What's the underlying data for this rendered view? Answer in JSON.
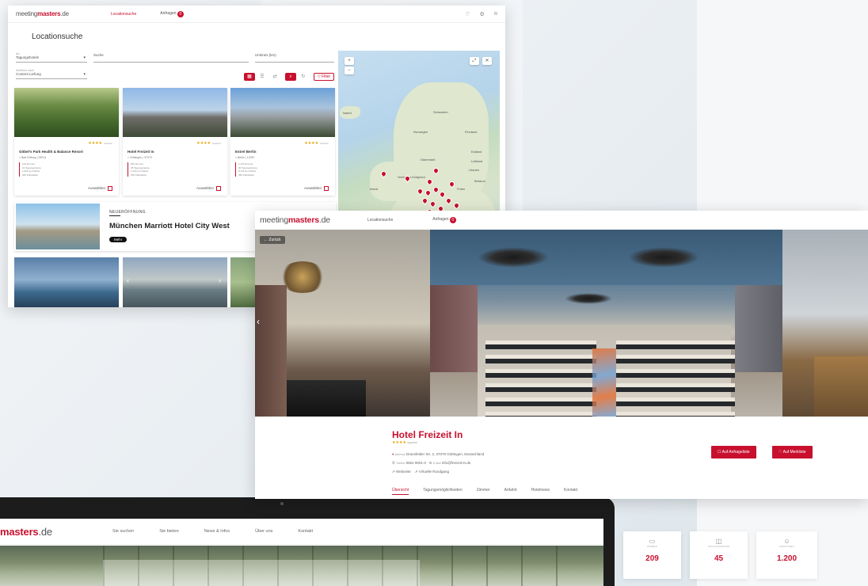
{
  "colors": {
    "accent": "#c8102e",
    "star": "#e8a200"
  },
  "brand": {
    "logo_prefix": "meeting",
    "logo_bold": "masters",
    "logo_tld": ".de",
    "logo_short": "masters",
    "logo_short_tld": ".de"
  },
  "search_screen": {
    "nav_active": "Locationsuche",
    "nav_requests": "Anfragen",
    "requests_count": "0",
    "page_title": "Locationsuche",
    "filter1_label": "Art",
    "filter1_value": "Tagungshotels",
    "search_value": "Suche",
    "filter3_value": "Umkreis (km)",
    "sort_label": "Sortieren nach",
    "sort_value": "Content Liefung",
    "filter_button": "Filter",
    "select_label": "Auswählen",
    "cards": [
      {
        "title": "Göbel’s Park Health & Balance Resort",
        "addr": "Bad Driburg | 33014",
        "stars": "★★★★",
        "stars_note": "superior",
        "d1": "194 Zimmer",
        "d2": "16 Tagungsräume",
        "d3": "1.000 qm Fläche",
        "d4": "400 Parkplätze"
      },
      {
        "title": "Hotel Freizeit In",
        "addr": "Göttingen | 37079",
        "stars": "★★★★",
        "stars_note": "superior",
        "d1": "209 Zimmer",
        "d2": "45 Tagungsräume",
        "d3": "1.200 qm Fläche",
        "d4": "150 Parkplätze"
      },
      {
        "title": "Estrel Berlin",
        "addr": "Berlin | 12057",
        "stars": "★★★★",
        "stars_note": "superior",
        "d1": "1.125 Zimmer",
        "d2": "60 Tagungsräume",
        "d3": "8.700 qm Fläche",
        "d4": "450 Parkplätze"
      }
    ],
    "banner_kicker": "NEUERÖFFNUNG",
    "banner_title": "München Marriott Hotel City West",
    "banner_button": "Mehr"
  },
  "map": {
    "labels": [
      "Schweden",
      "Finnland",
      "Norwegen",
      "Estland",
      "Lettland",
      "Litauen",
      "Dänemark",
      "Island",
      "Irland",
      "Belarus",
      "Polen",
      "Vereinigtes Königreich"
    ],
    "zoom_in": "+",
    "zoom_out": "−"
  },
  "hotel_screen": {
    "nav_search": "Locationsuche",
    "nav_requests": "Anfragen",
    "requests_count": "0",
    "back": "Zurück",
    "title": "Hotel Freizeit In",
    "stars": "★★★★",
    "stars_note": "superior",
    "address_label": "Adresse",
    "address": "Dransfelder Str. 3, 37079 Göttingen, Deutschland",
    "phone_label": "Telefon",
    "phone": "0551 9001-0",
    "email_label": "E-Mail",
    "email": "info@freizeit-in.de",
    "website": "Webseite",
    "virtual_tour": "Virtuelle Rundgang",
    "btn_requestlist": "Auf Anfrageliste",
    "btn_wishlist": "Auf Merkliste",
    "tabs": [
      "Übersicht",
      "Tagungsmöglichkeiten",
      "Zimmer",
      "Anfahrt",
      "Hotelnews",
      "Kontakt"
    ]
  },
  "home_screen": {
    "nav": [
      "Sie suchen",
      "Sie bieten",
      "News & Infos",
      "Über uns",
      "Kontakt"
    ]
  },
  "stats": [
    {
      "label": "ZIMMER",
      "value": "209",
      "icon": "bed-icon"
    },
    {
      "label": "TAGUNGSRÄUME",
      "value": "45",
      "icon": "presentation-icon"
    },
    {
      "label": "PERSONEN",
      "value": "1.200",
      "icon": "people-icon"
    }
  ]
}
